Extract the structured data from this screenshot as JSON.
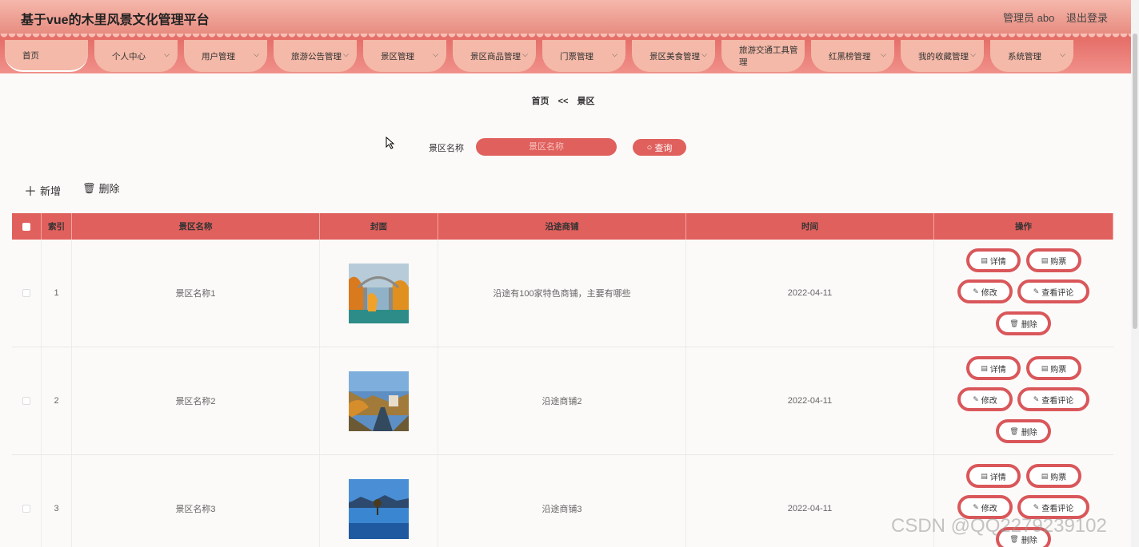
{
  "header": {
    "title": "基于vue的木里风景文化管理平台",
    "user": "管理员 abo",
    "logout": "退出登录"
  },
  "nav": [
    {
      "label": "首页",
      "chevron": false
    },
    {
      "label": "个人中心",
      "chevron": true
    },
    {
      "label": "用户管理",
      "chevron": true
    },
    {
      "label": "旅游公告管理",
      "chevron": true
    },
    {
      "label": "景区管理",
      "chevron": true
    },
    {
      "label": "景区商品管理",
      "chevron": true
    },
    {
      "label": "门票管理",
      "chevron": true
    },
    {
      "label": "景区美食管理",
      "chevron": true
    },
    {
      "label": "旅游交通工具管理",
      "chevron": true
    },
    {
      "label": "红黑榜管理",
      "chevron": true
    },
    {
      "label": "我的收藏管理",
      "chevron": true
    },
    {
      "label": "系统管理",
      "chevron": true
    }
  ],
  "breadcrumb": {
    "home": "首页",
    "sep": "<<",
    "current": "景区"
  },
  "search": {
    "label": "景区名称",
    "placeholder": "景区名称",
    "button": "查询"
  },
  "toolbar": {
    "add": "新增",
    "delete": "删除"
  },
  "table": {
    "columns": [
      "索引",
      "景区名称",
      "封面",
      "沿途商铺",
      "时间",
      "操作"
    ],
    "rows": [
      {
        "index": "1",
        "name": "景区名称1",
        "shops": "沿途有100家特色商铺，主要有哪些",
        "time": "2022-04-11"
      },
      {
        "index": "2",
        "name": "景区名称2",
        "shops": "沿途商铺2",
        "time": "2022-04-11"
      },
      {
        "index": "3",
        "name": "景区名称3",
        "shops": "沿途商铺3",
        "time": "2022-04-11"
      }
    ],
    "actions": {
      "detail": "详情",
      "buy": "购票",
      "edit": "修改",
      "comments": "查看评论",
      "delete": "删除"
    }
  },
  "watermark": "CSDN @QQ2279239102",
  "colors": {
    "accent": "#e0605d",
    "nav": "#f4b9a8"
  }
}
